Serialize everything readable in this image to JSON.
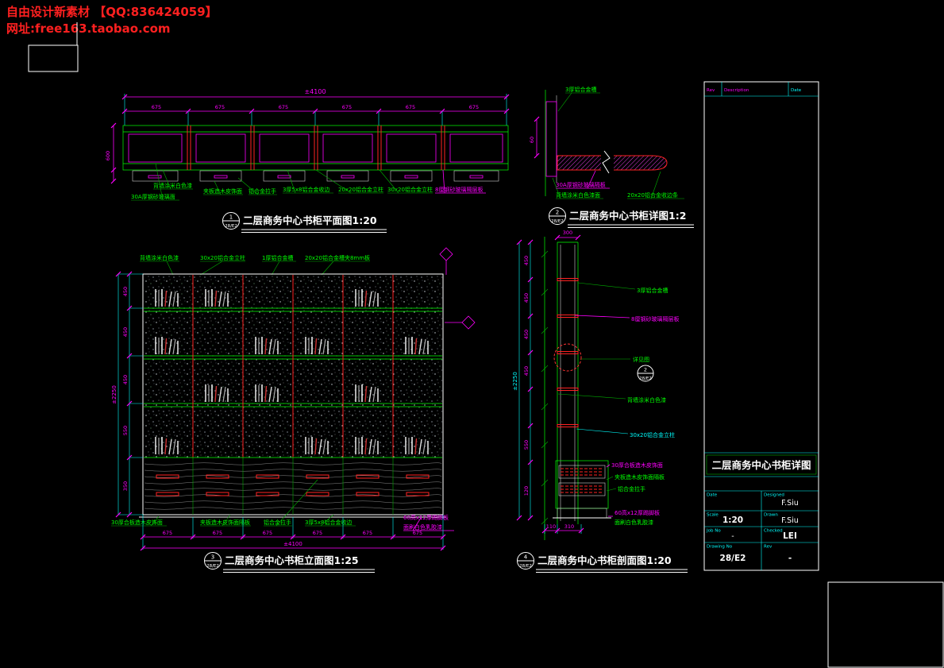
{
  "watermark": {
    "line1": "自由设计新素材  【QQ:836424059】",
    "line2": "网址:free163.taobao.com"
  },
  "plan": {
    "ref_num": "1",
    "ref_sheet": "28/E2",
    "title": "二层商务中心书柜平面图1:20",
    "dims": {
      "overall": "±4100",
      "segment": "675",
      "left": "600"
    },
    "labels": {
      "back_wall": "背墙涂米白色漆",
      "glass_face": "30A厚钢砂玻璃面",
      "plywood": "夹板造木皮饰面",
      "handle": "铝合金拉手",
      "alu_edge": "3厚5x8铝合金收边",
      "post_20": "20x20铝合金立柱",
      "post_30": "30x20铝合金立柱",
      "glass_shelf": "8厘钢砂玻璃隔层板"
    }
  },
  "detail": {
    "ref_num": "2",
    "ref_sheet": "28/E2",
    "title": "二层商务中心书柜详图1:2",
    "dims": {
      "depth": "60"
    },
    "labels": {
      "alu_channel": "3厚铝合金槽",
      "glass_shelf": "30A厚钢砂玻璃隔板",
      "back_wall": "背墙涂米白色漆面",
      "alu_trim": "20x20铝合金收边条"
    }
  },
  "elevation": {
    "ref_num": "3",
    "ref_sheet": "28/E2",
    "title": "二层商务中心书柜立面图1:25",
    "dims": {
      "overall_w": "±4100",
      "segment_w": "675",
      "overall_h": "±2250",
      "segments_h": [
        "450",
        "450",
        "450",
        "550",
        "350"
      ]
    },
    "top_labels": {
      "back_wall": "背墙涂米白色漆",
      "post": "30x20铝合金立柱",
      "channel": "1厚铝合金槽",
      "glass": "20x20铝合金槽夹8mm板"
    },
    "bottom_labels": {
      "counter": "30厚合板造木皮饰面",
      "divider": "夹板造木皮饰面隔板",
      "handle": "铝合金拉手",
      "edge": "3厚5x8铝合金收边",
      "skirting": "60高x12厚踢脚板",
      "paint": "面刷白色乳胶漆"
    }
  },
  "section": {
    "ref_num": "4",
    "ref_sheet": "28/E2",
    "title": "二层商务中心书柜剖面图1:20",
    "detail_ref": {
      "text": "详见图",
      "num": "2",
      "sheet": "28/E2"
    },
    "dims": {
      "top": "300",
      "overall_h": "±2250",
      "segments_h": [
        "450",
        "450",
        "450",
        "450",
        "550",
        "120"
      ],
      "bottom": [
        "110",
        "310"
      ]
    },
    "labels": {
      "channel": "3厚铝合金槽",
      "glass_shelf": "8厘钢砂玻璃隔层板",
      "back_wall": "背墙涂米白色漆",
      "post": "30x20铝合金立柱",
      "counter": "30厚合板造木皮饰面",
      "divider": "夹板造木皮饰面隔板",
      "handle": "铝合金拉手",
      "skirting": "60高x12厚踢脚板",
      "paint": "面刷白色乳胶漆"
    }
  },
  "titleblock": {
    "header": {
      "col1": "Rev",
      "col2": "Description",
      "col3": "Date"
    },
    "drawing_title": "二层商务中心书柜详图",
    "rows": {
      "r1_left_label": "Date",
      "r1_left_value": "",
      "r1_right_label": "Designed",
      "r1_right_value": "F.Siu",
      "r2_left_label": "Scale",
      "r2_left_value": "1:20",
      "r2_right_label": "Drawn",
      "r2_right_value": "F.Siu",
      "r3_left_label": "Job No",
      "r3_left_value": "-",
      "r3_right_label": "Checked",
      "r3_right_value": "LEI",
      "r4_left_label": "Drawing No",
      "r4_left_value": "28/E2",
      "r4_right_label": "Rev",
      "r4_right_value": "-"
    }
  }
}
